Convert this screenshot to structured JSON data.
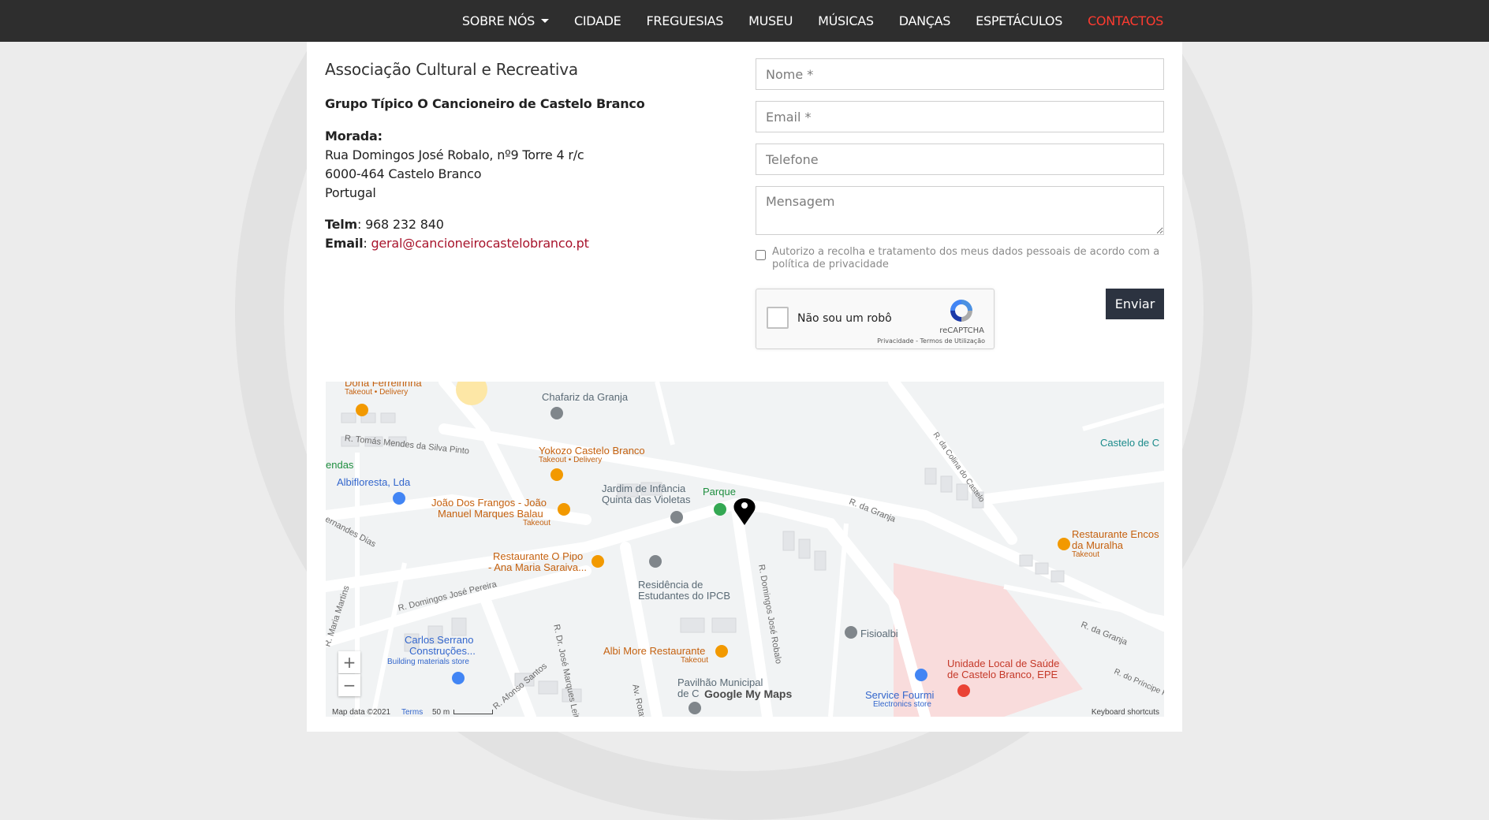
{
  "nav": {
    "items": [
      {
        "label": "SOBRE NÓS",
        "dropdown": true
      },
      {
        "label": "CIDADE"
      },
      {
        "label": "FREGUESIAS"
      },
      {
        "label": "MUSEU"
      },
      {
        "label": "MÚSICAS"
      },
      {
        "label": "DANÇAS"
      },
      {
        "label": "ESPETÁCULOS"
      },
      {
        "label": "CONTACTOS",
        "active": true
      }
    ],
    "active_color": "#ff3b30"
  },
  "info": {
    "association": "Associação Cultural e Recreativa",
    "group": "Grupo Típico O Cancioneiro de Castelo Branco",
    "address_label": "Morada:",
    "address_line1": "Rua Domingos José Robalo, nº9 Torre 4 r/c",
    "address_line2": "6000-464 Castelo Branco",
    "address_line3": "Portugal",
    "phone_label": "Telm",
    "phone": "968 232 840",
    "email_label": "Email",
    "email": "geral@cancioneirocastelobranco.pt"
  },
  "form": {
    "name_placeholder": "Nome *",
    "email_placeholder": "Email *",
    "phone_placeholder": "Telefone",
    "message_placeholder": "Mensagem",
    "consent": "Autorizo a recolha e tratamento dos meus dados pessoais de acordo com a política de privacidade",
    "captcha_label": "Não sou um robô",
    "captcha_brand": "reCAPTCHA",
    "captcha_links": "Privacidade - Termos de Utilização",
    "send_label": "Enviar"
  },
  "map": {
    "labels": {
      "dona": "Dona Ferreirinha",
      "takeout_delivery": "Takeout • Delivery",
      "chafariz": "Chafariz da Granja",
      "tomas": "R. Tomás Mendes da Silva Pinto",
      "yokozo": "Yokozo Castelo Branco",
      "endas": "endas",
      "albiflo": "Albiflorestа, Lda",
      "joao1": "João Dos Frangos - João",
      "joao2": "Manuel Marques Balau",
      "takeout": "Takeout",
      "jardim1": "Jardim de Infância",
      "jardim2": "Quinta das Violetas",
      "parque": "Parque",
      "granja": "R. da Granja",
      "colina": "R. da Colina do Castelo",
      "castelo": "Castelo de C",
      "pipo1": "Restaurante O Pipo",
      "pipo2": "- Ana Maria Saraiva...",
      "fernandes": "ernandes Dias",
      "residencia1": "Residência de",
      "residencia2": "Estudantes do IPCB",
      "djp": "R. Domingos José Pereira",
      "djr": "R. Domingos José Robalo",
      "maria": "R. Maria Martins",
      "carlos1": "Carlos Serrano",
      "carlos2": "Construções...",
      "building": "Building materials store",
      "drjose": "R. Dr. José Marques Leite",
      "albimore": "Albi More Restaurante",
      "fisio": "Fisioalbi",
      "encosta1": "Restaurante Encos",
      "encosta2": "da Muralha",
      "granja2": "R. da Granja",
      "unidade1": "Unidade Local de Saúde",
      "unidade2": "de Castelo Branco, EPE",
      "pavilhao1": "Pavilhão Municipal",
      "pavilhao2": "de C",
      "service": "Service Fourmi",
      "electronics": "Electronics store",
      "afonso": "R. Afonso Santos",
      "rotary": "Av. Rotary",
      "principe": "R. do Príncipe Perfeito"
    },
    "google": "Google My Maps",
    "map_data": "Map data ©2021",
    "terms": "Terms",
    "scale": "50 m",
    "shortcuts": "Keyboard shortcuts",
    "zoom_in": "+",
    "zoom_out": "−"
  }
}
